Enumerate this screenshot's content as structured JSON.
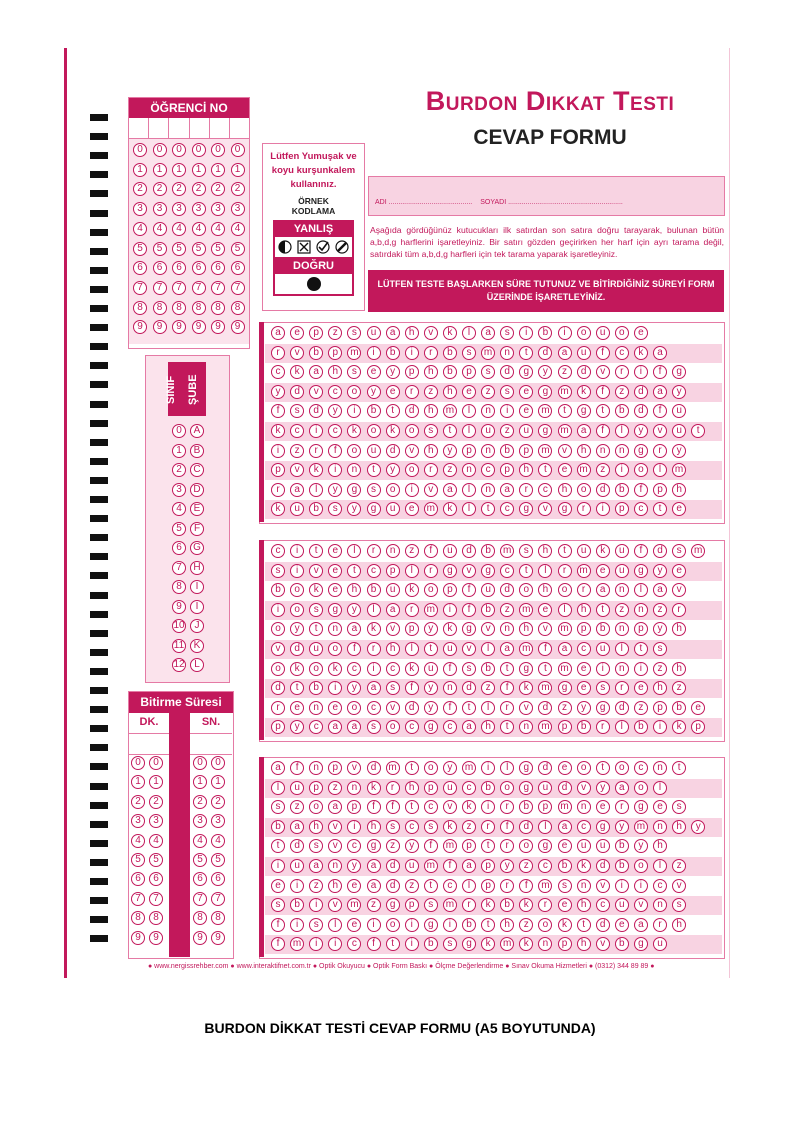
{
  "header": {
    "title": "Burdon Dikkat Testi",
    "subtitle": "CEVAP FORMU"
  },
  "student_no": {
    "title": "ÖĞRENCİ NO",
    "columns": 6,
    "digits": [
      "0",
      "1",
      "2",
      "3",
      "4",
      "5",
      "6",
      "7",
      "8",
      "9"
    ]
  },
  "instructions": {
    "pencil_note": "Lütfen Yumuşak ve koyu kurşunkalem kullanınız.",
    "example_title": "ÖRNEK KODLAMA",
    "wrong_label": "YANLIŞ",
    "right_label": "DOĞRU"
  },
  "name_box": {
    "name_label": "ADI",
    "name_dots": "...........................................",
    "surname_label": "SOYADI",
    "surname_dots": "..........................................................."
  },
  "description": "Aşağıda gördüğünüz kutucukları ilk satırdan son satıra doğru tarayarak, bulunan bütün a,b,d,g harflerini işaretleyiniz. Bir satırı gözden geçirirken her harf için ayrı tarama değil, satırdaki tüm a,b,d,g harfleri için tek tarama yaparak işaretleyiniz.",
  "time_note": "LÜTFEN TESTE BAŞLARKEN SÜRE TUTUNUZ VE BİTİRDİĞİNİZ SÜREYİ FORM ÜZERİNDE İŞARETLEYİNİZ.",
  "class_panel": {
    "sinif_label": "SINIF",
    "sube_label": "ŞUBE",
    "rows": [
      [
        "0",
        "A"
      ],
      [
        "1",
        "B"
      ],
      [
        "2",
        "C"
      ],
      [
        "3",
        "D"
      ],
      [
        "4",
        "E"
      ],
      [
        "5",
        "F"
      ],
      [
        "6",
        "G"
      ],
      [
        "7",
        "H"
      ],
      [
        "8",
        "I"
      ],
      [
        "9",
        "İ"
      ],
      [
        "10",
        "J"
      ],
      [
        "11",
        "K"
      ],
      [
        "12",
        "L"
      ]
    ]
  },
  "finish_panel": {
    "title": "Bitirme Süresi",
    "min_label": "DK.",
    "sec_label": "SN.",
    "digits": [
      "0",
      "1",
      "2",
      "3",
      "4",
      "5",
      "6",
      "7",
      "8",
      "9"
    ]
  },
  "letter_sections": [
    [
      "aepzsuahvklasibiouoe",
      "rvbpmibirbsmntdaufcka",
      "ckahseyphbpsdgyzdvrifg",
      "ydvcoyerzhezsegmkfzday",
      "fsdyibtdhmlniemtgtbdfu",
      "kcickokostluzugmaflyvut",
      "izrfoudvhypnbpmvhnngry",
      "pvkintyorzncphtemziolm",
      "ralygsoivalnarchodbfph",
      "kubsyguemkltcgvgripcte"
    ],
    [
      "citelrnzfudbmshtukufdsm",
      "sivetcplrgvgctlrmeugye",
      "bokehbukopfudohoranlav",
      "iosgylarmifbzmelhtznzr",
      "oytnakvpykgvnhvmpbnpyh",
      "vduofrhltuvlamfacults",
      "okokcickufsbtgtmeinizh",
      "dtbiyasfyndzfkmgesrehz",
      "reneocvdyftlrvdzygdzpbe",
      "pycaasocgcahtnmpbrlbikp"
    ],
    [
      "afnpvdmtoymilgdeotocnt",
      "lupznkrhpucbogudvyaol",
      "szoapfftcvkirbpmnerges",
      "bahvihscskzrfdlacgymnhy",
      "tdsvcgzyfmptrogeuubyh",
      "iuanyadumfapyzcbkdbolz",
      "eizheadztclprfmsnviicv",
      "sbivmzgpsmrkbkrehcuvns",
      "fisleioigibthzoktdearh",
      "fmiicftibsgkmknphvbgu"
    ]
  ],
  "footer": {
    "text": "● www.nergissrehber.com ● www.interaktifnet.com.tr ● Optik Okuyucu ● Optik Form Baskı ● Ölçme Değerlendirme ● Sınav Okuma Hizmetleri ● (0312) 344 89 89 ●"
  },
  "caption": "BURDON DİKKAT TESTİ CEVAP FORMU (A5 BOYUTUNDA)",
  "colors": {
    "accent": "#c2185b",
    "light": "#f8d3e2",
    "mid": "#e57aa5"
  }
}
